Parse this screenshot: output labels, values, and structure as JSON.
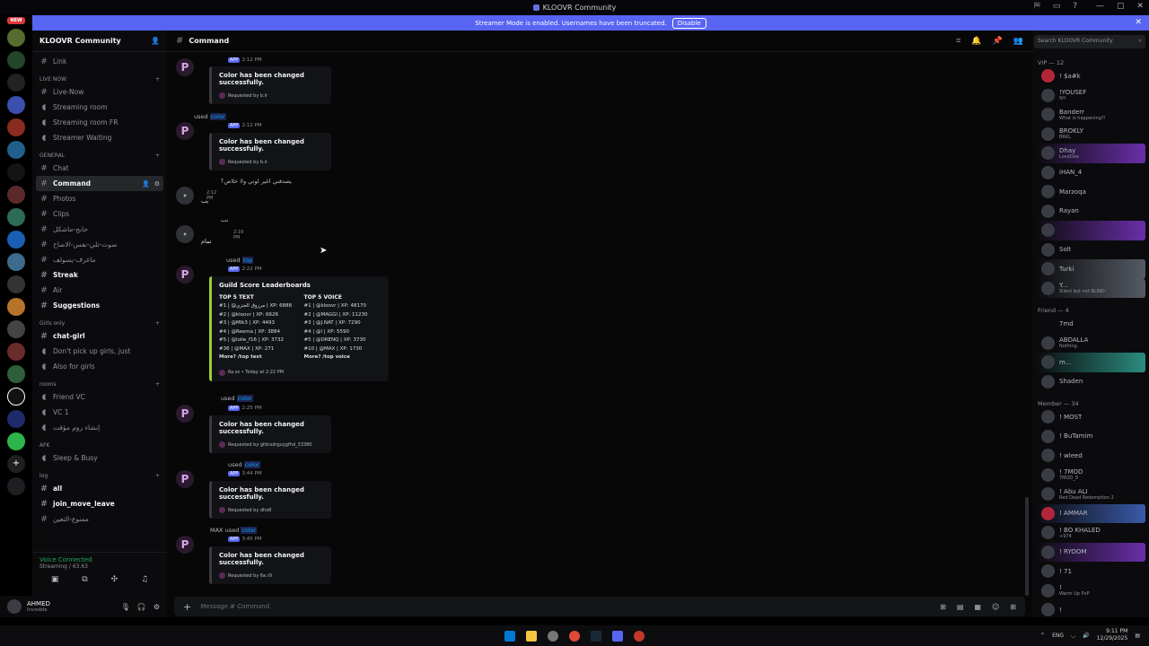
{
  "window": {
    "title": "KLOOVR Community"
  },
  "banner": {
    "text": "Streamer Mode is enabled. Usernames have been truncated.",
    "button": "Disable"
  },
  "rail": {
    "new_label": "NEW"
  },
  "server": {
    "name": "KLOOVR Community"
  },
  "sidebar": {
    "top": [
      {
        "label": "Link"
      }
    ],
    "live": {
      "category": "LIVE NOW",
      "items": [
        {
          "label": "Live-Now"
        },
        {
          "label": "Streaming room"
        },
        {
          "label": "Streaming room FR"
        },
        {
          "label": "Streamer Waiting"
        }
      ]
    },
    "general": {
      "category": "GENERAL",
      "items": [
        {
          "label": "Chat"
        },
        {
          "label": "Command"
        },
        {
          "label": "Photos"
        },
        {
          "label": "Clips"
        },
        {
          "label": "حابح-ماشكل"
        },
        {
          "label": "صوت-تلي-نفس-الاضاح"
        },
        {
          "label": "ماغرف-يسولف"
        },
        {
          "label": "Streak"
        },
        {
          "label": "Air"
        },
        {
          "label": "Suggestions"
        }
      ]
    },
    "girls": {
      "category": "Girls only",
      "items": [
        {
          "label": "chat-girl"
        },
        {
          "label": "Don't pick up girls, just"
        },
        {
          "label": "Also for girls"
        }
      ]
    },
    "rooms": {
      "category": "rooms",
      "items": [
        {
          "label": "Friend VC"
        },
        {
          "label": "VC 1"
        },
        {
          "label": "إنشاء روم مؤقت"
        }
      ]
    },
    "afk": {
      "category": "AFK",
      "items": [
        {
          "label": "Sleep & Busy"
        }
      ]
    },
    "log": {
      "category": "log",
      "items": [
        {
          "label": "all"
        },
        {
          "label": "join_move_leave"
        },
        {
          "label": "ممنوع-التعين"
        }
      ]
    }
  },
  "voice": {
    "status": "Voice Connected",
    "sub": "Streaming / 63.63"
  },
  "user": {
    "name": "AHMED",
    "status": "Invisible"
  },
  "channel": {
    "title": "Command"
  },
  "messages": [
    {
      "time": "2:12 PM",
      "app": "APP",
      "title": "Color has been changed successfully.",
      "footer": "Requested by b.ir"
    },
    {
      "reply": "used",
      "command": "color",
      "time": "2:12 PM",
      "app": "APP",
      "title": "Color has been changed successfully.",
      "footer": "Requested by b.ir"
    },
    {
      "text": "يصدقني اغير لوني ولا خلاص؟",
      "time": "2:12 PM",
      "body": "بب"
    },
    {
      "text": "بب",
      "time": "2:19 PM",
      "body": "تمام"
    },
    {
      "reply": "used",
      "command": "top",
      "time": "2:22 PM",
      "app": "APP"
    },
    {
      "reply": "used",
      "command": "color",
      "time": "2:25 PM",
      "app": "APP",
      "title": "Color has been changed successfully.",
      "footer": "Requested by gfdcsdrguygfhd_33380"
    },
    {
      "reply": "used",
      "command": "color",
      "time": "3:44 PM",
      "app": "APP",
      "title": "Color has been changed successfully.",
      "footer": "Requested by dhx8"
    },
    {
      "reply": "MAX used",
      "command": "color",
      "time": "3:45 PM",
      "app": "APP",
      "title": "Color has been changed successfully.",
      "footer": "Requested by 6a.r9"
    }
  ],
  "leaderboard": {
    "title": "Guild Score Leaderboards",
    "text_header": "TOP 5 TEXT",
    "voice_header": "TOP 5 VOICE",
    "text_rows": [
      "#1 | @مرزوق العنزي | XP: 6888",
      "#2 | @kloovr | XP: 6626",
      "#3 | @Mlk3 | XP: 4493",
      "#4 | @Reema | XP: 3884",
      "#5 | @lolie_f16 | XP: 3732",
      "#36 | @MAX | XP: 271"
    ],
    "voice_rows": [
      "#1 | @kloovr | XP: 48170",
      "#2 | @MAGGI | XP: 11230",
      "#3 | @J.NAT | XP: 7290",
      "#4 | @l | XP: 5590",
      "#5 | @DRENQ | XP: 3730",
      "#10 | @MAX | XP: 1730"
    ],
    "more_text": "More? /top text",
    "more_voice": "More? /top voice",
    "footer": "6a.zz • Today at 2:22 PM"
  },
  "composer": {
    "placeholder": "Message #  Command"
  },
  "members": {
    "search": "Search KLOOVR Community",
    "vip": {
      "category": "VIP — 12",
      "items": [
        {
          "name": "! $a#k",
          "status": ""
        },
        {
          "name": "!YOUSEF",
          "status": "5H"
        },
        {
          "name": "Banderr",
          "status": "What is happening?!"
        },
        {
          "name": "BROKLY",
          "status": "BRKL"
        },
        {
          "name": "Dhay",
          "status": "LoveDee"
        },
        {
          "name": "iHAN_4",
          "status": ""
        },
        {
          "name": "Marzoqa",
          "status": ""
        },
        {
          "name": "Rayan",
          "status": ""
        },
        {
          "name": "",
          "status": ""
        },
        {
          "name": "Solt",
          "status": ""
        },
        {
          "name": "Turki",
          "status": ""
        },
        {
          "name": "Y...",
          "status": "Silent but not BLIND"
        }
      ]
    },
    "friend": {
      "category": "Friend — 4",
      "items": [
        {
          "name": "7md",
          "status": ""
        },
        {
          "name": "ABDALLA",
          "status": "Nothing."
        },
        {
          "name": "m...",
          "status": ""
        },
        {
          "name": "Shaden",
          "status": ""
        }
      ]
    },
    "member": {
      "category": "Member — 34",
      "items": [
        {
          "name": "! MOST",
          "status": ""
        },
        {
          "name": "! BuTamim",
          "status": ""
        },
        {
          "name": "! wleed",
          "status": ""
        },
        {
          "name": "! 7MOD",
          "status": "7MOD_9"
        },
        {
          "name": "! Abu ALI",
          "status": "Red Dead Redemption 2"
        },
        {
          "name": "! AMMAR",
          "status": ""
        },
        {
          "name": "! BO KHALED",
          "status": "+974"
        },
        {
          "name": "! RYOOM",
          "status": ""
        },
        {
          "name": "! 71",
          "status": ""
        },
        {
          "name": "!",
          "status": "Warm Up PvP"
        },
        {
          "name": "!",
          "status": ""
        }
      ]
    }
  },
  "taskbar": {
    "lang": "ENG",
    "time": "9:11 PM",
    "date": "12/29/2025"
  }
}
